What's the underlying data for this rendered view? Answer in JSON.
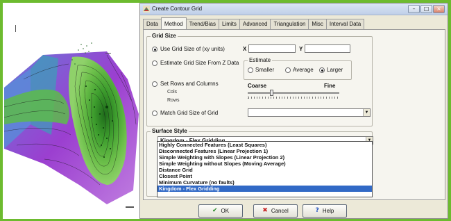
{
  "window": {
    "title": "Create Contour Grid",
    "controls": [
      "minimize",
      "maximize",
      "close"
    ]
  },
  "tabs": [
    "Data",
    "Method",
    "Trend/Bias",
    "Limits",
    "Advanced",
    "Triangulation",
    "Misc",
    "Interval Data"
  ],
  "active_tab": "Method",
  "grid_size": {
    "title": "Grid Size",
    "option_use_xy": "Use Grid Size of (xy units)",
    "x_label": "X",
    "y_label": "Y",
    "option_estimate": "Estimate Grid Size From Z Data",
    "estimate_title": "Estimate",
    "estimate_options": [
      "Smaller",
      "Average",
      "Larger"
    ],
    "estimate_selected": "Larger",
    "option_rows_cols": "Set Rows and Columns",
    "cols_label": "Cols",
    "rows_label": "Rows",
    "coarse_label": "Coarse",
    "fine_label": "Fine",
    "option_match": "Match Grid Size of Grid",
    "selected_option": "Use Grid Size of (xy units)"
  },
  "surface_style": {
    "title": "Surface Style",
    "selected": "Kingdom - Flex Gridding",
    "options": [
      "Highly Connected Features (Least Squares)",
      "Disconnected Features (Linear Projection 1)",
      "Simple Weighting with Slopes (Linear Projection 2)",
      "Simple Weighting without Slopes (Moving Average)",
      "Distance Grid",
      "Closest Point",
      "Minimum Curvature (no faults)",
      "Kingdom - Flex Gridding"
    ]
  },
  "buttons": {
    "ok": "OK",
    "cancel": "Cancel",
    "help": "Help"
  },
  "icons": {
    "ok": "check-icon",
    "cancel": "x-icon",
    "help": "question-icon"
  },
  "colors": {
    "frame": "#6dbb2f",
    "selection": "#3169c6",
    "map_purple": "#9b3fd0",
    "map_green": "#3e9e2e"
  }
}
